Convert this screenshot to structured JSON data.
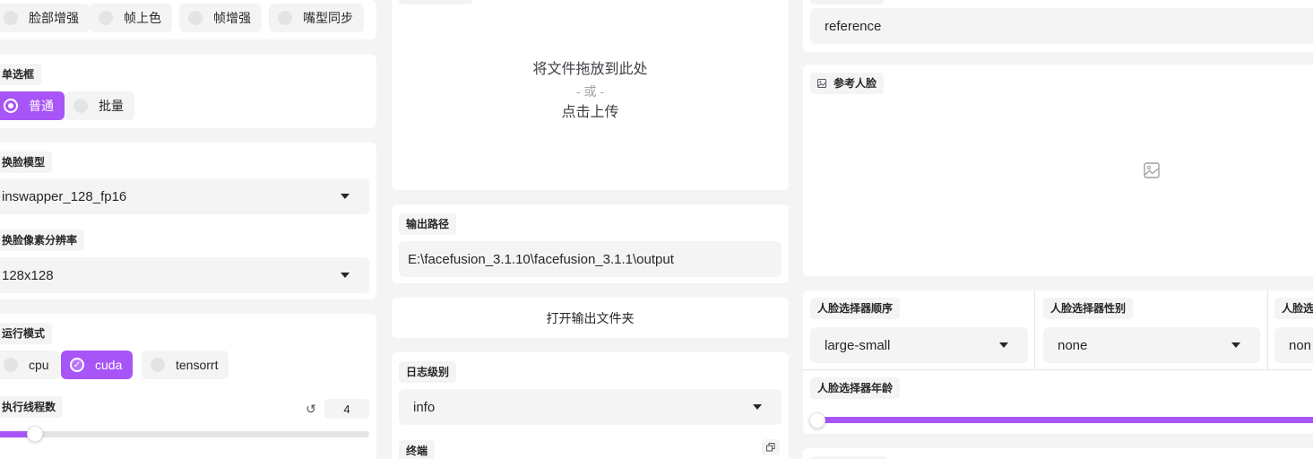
{
  "colors": {
    "accent": "#a855f7",
    "panel": "#ffffff",
    "background": "#f4f4f5",
    "field": "#f4f4f5"
  },
  "left": {
    "processors": [
      "脸部增强",
      "帧上色",
      "帧增强",
      "嘴型同步"
    ],
    "mode": {
      "label": "单选框",
      "options": [
        "普通",
        "批量"
      ],
      "selected": "普通"
    },
    "face_swapper_model": {
      "label": "换脸模型",
      "value": "inswapper_128_fp16"
    },
    "face_swapper_resolution": {
      "label": "换脸像素分辨率",
      "value": "128x128"
    },
    "execution_providers": {
      "label": "运行模式",
      "options": [
        "cpu",
        "cuda",
        "tensorrt"
      ],
      "checked": "cuda"
    },
    "thread_count": {
      "label": "执行线程数",
      "value": "4",
      "reset_icon": "reset-icon",
      "fraction": 0.05
    }
  },
  "middle": {
    "upload": {
      "line1": "将文件拖放到此处",
      "line2": "- 或 -",
      "line3": "点击上传"
    },
    "output_path": {
      "label": "输出路径",
      "value": "E:\\facefusion_3.1.10\\facefusion_3.1.1\\output"
    },
    "open_folder_button": "打开输出文件夹",
    "log_level": {
      "label": "日志级别",
      "value": "info"
    },
    "terminal": {
      "label": "终端",
      "copy_icon": "copy-icon"
    }
  },
  "right": {
    "reference_value": "reference",
    "reference_face": {
      "label": "参考人脸",
      "icon": "image-icon",
      "placeholder_icon": "image-placeholder-icon"
    },
    "face_selector_order": {
      "label": "人脸选择器顺序",
      "value": "large-small"
    },
    "face_selector_gender": {
      "label": "人脸选择器性别",
      "value": "none"
    },
    "face_selector_race": {
      "label": "人脸选",
      "value": "non"
    },
    "face_selector_age": {
      "label": "人脸选择器年龄",
      "fraction_start": 0.0,
      "fraction_end": 1.0
    }
  }
}
